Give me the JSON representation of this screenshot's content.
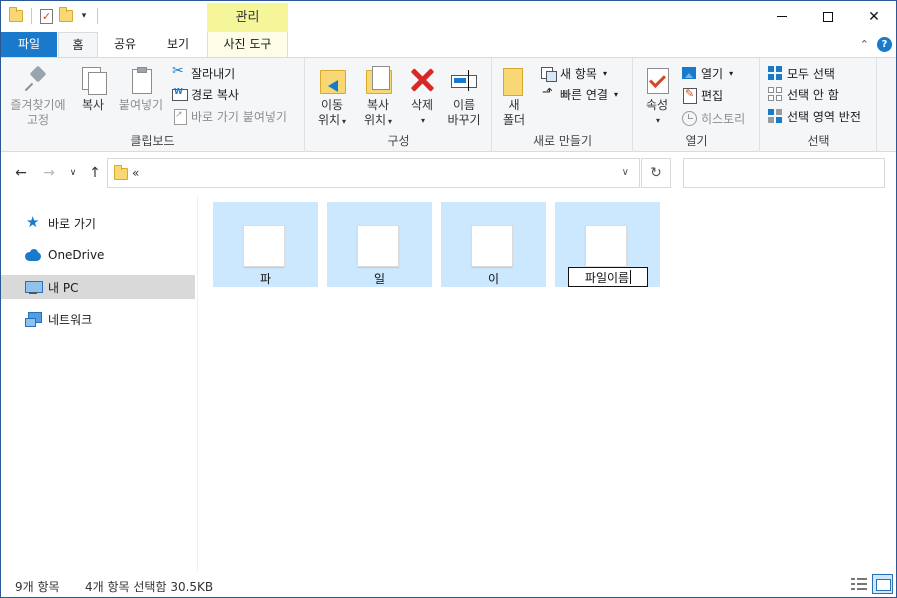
{
  "window": {
    "context_tab_header": "관리",
    "controls": {
      "minimize": "minimize",
      "maximize": "maximize",
      "close": "close"
    }
  },
  "tabs": {
    "file": "파일",
    "home": "홈",
    "share": "공유",
    "view": "보기",
    "photo_tools": "사진 도구"
  },
  "ribbon": {
    "clipboard": {
      "label": "클립보드",
      "pin_line1": "즐겨찾기에",
      "pin_line2": "고정",
      "copy": "복사",
      "paste": "붙여넣기",
      "cut": "잘라내기",
      "copy_path": "경로 복사",
      "paste_shortcut": "바로 가기 붙여넣기"
    },
    "organize": {
      "label": "구성",
      "move_line1": "이동",
      "move_line2": "위치",
      "copy_line1": "복사",
      "copy_line2": "위치",
      "delete": "삭제",
      "rename_line1": "이름",
      "rename_line2": "바꾸기"
    },
    "new": {
      "label": "새로 만들기",
      "folder_line1": "새",
      "folder_line2": "폴더",
      "new_item": "새 항목",
      "easy_access": "빠른 연결"
    },
    "open": {
      "label": "열기",
      "properties": "속성",
      "open": "열기",
      "edit": "편집",
      "history": "히스토리"
    },
    "select": {
      "label": "선택",
      "select_all": "모두 선택",
      "select_none": "선택 안 함",
      "invert": "선택 영역 반전"
    }
  },
  "address": {
    "path": "«",
    "search_placeholder": ""
  },
  "navpane": {
    "items": [
      {
        "label": "바로 가기",
        "icon": "quick-access-star-icon"
      },
      {
        "label": "OneDrive",
        "icon": "onedrive-cloud-icon"
      },
      {
        "label": "내 PC",
        "icon": "this-pc-icon",
        "selected": true
      },
      {
        "label": "네트워크",
        "icon": "network-icon"
      }
    ]
  },
  "files": [
    {
      "name": "파",
      "selected": true
    },
    {
      "name": "일",
      "selected": true
    },
    {
      "name": "이",
      "selected": true
    },
    {
      "name": "파일이름",
      "selected": true,
      "renaming": true
    }
  ],
  "status": {
    "item_count": "9개 항목",
    "selection": "4개 항목 선택함 30.5KB"
  },
  "colors": {
    "accent": "#1979ca",
    "context_tab": "#f5f59a",
    "selection": "#cce8ff",
    "delete_red": "#d82727"
  }
}
